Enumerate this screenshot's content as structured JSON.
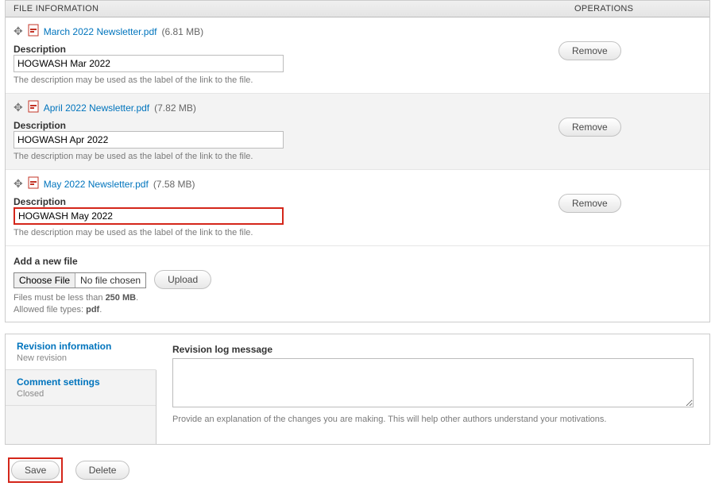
{
  "headers": {
    "file_info": "FILE INFORMATION",
    "operations": "OPERATIONS"
  },
  "files": [
    {
      "name": "March 2022 Newsletter.pdf",
      "size": "(6.81 MB)",
      "desc_label": "Description",
      "desc_value": "HOGWASH Mar 2022",
      "hint": "The description may be used as the label of the link to the file.",
      "remove": "Remove",
      "highlight": false
    },
    {
      "name": "April 2022 Newsletter.pdf",
      "size": "(7.82 MB)",
      "desc_label": "Description",
      "desc_value": "HOGWASH Apr 2022",
      "hint": "The description may be used as the label of the link to the file.",
      "remove": "Remove",
      "highlight": false
    },
    {
      "name": "May 2022 Newsletter.pdf",
      "size": "(7.58 MB)",
      "desc_label": "Description",
      "desc_value": "HOGWASH May 2022",
      "hint": "The description may be used as the label of the link to the file.",
      "remove": "Remove",
      "highlight": true
    }
  ],
  "add": {
    "label": "Add a new file",
    "choose": "Choose File",
    "none": "No file chosen",
    "upload": "Upload",
    "constraint_size_pre": "Files must be less than ",
    "constraint_size_val": "250 MB",
    "constraint_type_pre": "Allowed file types: ",
    "constraint_type_val": "pdf"
  },
  "tabs": [
    {
      "title": "Revision information",
      "sub": "New revision",
      "active": true
    },
    {
      "title": "Comment settings",
      "sub": "Closed",
      "active": false
    }
  ],
  "revision": {
    "label": "Revision log message",
    "value": "",
    "hint": "Provide an explanation of the changes you are making. This will help other authors understand your motivations."
  },
  "actions": {
    "save": "Save",
    "delete": "Delete"
  },
  "icons": {
    "move": "✥",
    "pdf": "🅿"
  }
}
